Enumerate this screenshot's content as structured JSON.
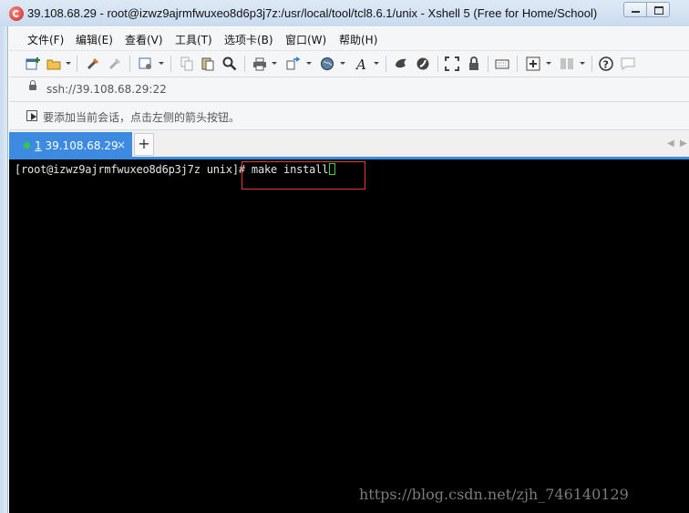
{
  "window": {
    "title": "39.108.68.29 - root@izwz9ajrmfwuxeo8d6p3j7z:/usr/local/tool/tcl8.6.1/unix - Xshell 5 (Free for Home/School)"
  },
  "menu": {
    "items": [
      "文件(F)",
      "编辑(E)",
      "查看(V)",
      "工具(T)",
      "选项卡(B)",
      "窗口(W)",
      "帮助(H)"
    ]
  },
  "toolbar": {
    "icons": [
      "new-session-icon",
      "open-folder-icon",
      "connect-icon",
      "disconnect-icon",
      "properties-icon",
      "copy-icon",
      "paste-icon",
      "find-icon",
      "print-icon",
      "transfer-icon",
      "globe-icon",
      "font-icon",
      "xftp-icon",
      "xmanager-icon",
      "fullscreen-icon",
      "lock-icon",
      "keyboard-icon",
      "add-icon",
      "layout-icon",
      "help-icon",
      "chat-icon"
    ]
  },
  "address": {
    "url": "ssh://39.108.68.29:22"
  },
  "hint": {
    "text": "要添加当前会话，点击左侧的箭头按钮。"
  },
  "tabs": {
    "active": {
      "number": "1",
      "label": "39.108.68.29",
      "close": "×"
    },
    "add": "+"
  },
  "terminal": {
    "prompt": "[root@izwz9ajrmfwuxeo8d6p3j7z unix]# ",
    "command": "make install"
  },
  "watermark": "https://blog.csdn.net/zjh_746140129",
  "colors": {
    "accent": "#3c8be0",
    "terminal_bg": "#000000",
    "highlight": "#e53935",
    "cursor": "#3fd13f"
  }
}
